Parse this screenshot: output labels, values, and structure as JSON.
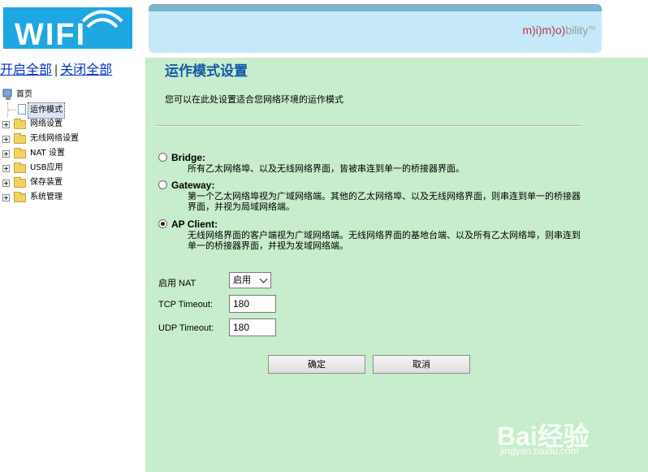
{
  "header": {
    "logo_text": "WIFI",
    "brand_m1": "m",
    "brand_i": "i",
    "brand_m2": "m",
    "brand_o": "o",
    "brand_rest": "bility",
    "brand_tm": "TM"
  },
  "sidebar": {
    "open_all": "开启全部",
    "separator": "|",
    "close_all": "关闭全部",
    "root_label": "首页",
    "items": [
      {
        "label": "运作模式"
      },
      {
        "label": "网络设置"
      },
      {
        "label": "无线网络设置"
      },
      {
        "label": "NAT 设置"
      },
      {
        "label": "USB应用"
      },
      {
        "label": "保存装置"
      },
      {
        "label": "系统管理"
      }
    ]
  },
  "main": {
    "title": "运作模式设置",
    "description": "您可以在此处设置适合您网络环境的运作模式",
    "options": [
      {
        "title": "Bridge:",
        "desc": "所有乙太网络埠、以及无线网络界面，皆被串连到单一的桥接器界面。",
        "selected": false
      },
      {
        "title": "Gateway:",
        "desc": "第一个乙太网络埠视为广域网络端。其他的乙太网络埠、以及无线网络界面，则串连到单一的桥接器界面，并视为局域网络端。",
        "selected": false
      },
      {
        "title": "AP Client:",
        "desc": "无线网络界面的客户端视为广域网络端。无线网络界面的基地台端、以及所有乙太网络埠，则串连到单一的桥接器界面，并视为发域网络端。",
        "selected": true
      }
    ],
    "nat_label": "启用  NAT",
    "nat_value": "启用",
    "tcp_label": "TCP Timeout:",
    "tcp_value": "180",
    "udp_label": "UDP Timeout:",
    "udp_value": "180",
    "ok_button": "确定",
    "cancel_button": "取消"
  },
  "watermark": {
    "text": "Bai经验",
    "sub": "jingyan.baidu.com"
  }
}
